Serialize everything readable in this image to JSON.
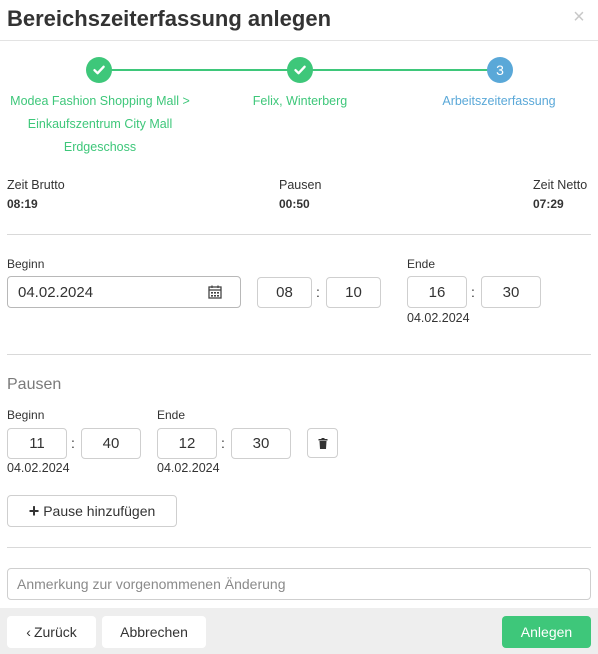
{
  "dialog": {
    "title": "Bereichszeiterfassung anlegen",
    "close_icon": "×"
  },
  "steps": [
    {
      "label": "Modea Fashion Shopping Mall > Einkaufszentrum City Mall Erdgeschoss",
      "state": "done",
      "color": "#3ec77a"
    },
    {
      "label": "Felix, Winterberg",
      "state": "done",
      "color": "#3ec77a"
    },
    {
      "label": "Arbeitszeiterfassung",
      "state": "active",
      "number": "3",
      "color": "#5aa8d8"
    }
  ],
  "summary": {
    "brutto_label": "Zeit Brutto",
    "brutto_value": "08:19",
    "pausen_label": "Pausen",
    "pausen_value": "00:50",
    "netto_label": "Zeit Netto",
    "netto_value": "07:29"
  },
  "work": {
    "beginn_label": "Beginn",
    "beginn_date": "04.02.2024",
    "beginn_hour": "08",
    "beginn_minute": "10",
    "ende_label": "Ende",
    "ende_hour": "16",
    "ende_minute": "30",
    "ende_date": "04.02.2024"
  },
  "pausen": {
    "title": "Pausen",
    "items": [
      {
        "beginn_label": "Beginn",
        "beginn_hour": "11",
        "beginn_minute": "40",
        "beginn_date": "04.02.2024",
        "ende_label": "Ende",
        "ende_hour": "12",
        "ende_minute": "30",
        "ende_date": "04.02.2024"
      }
    ],
    "add_label": "Pause hinzufügen"
  },
  "remark": {
    "placeholder": "Anmerkung zur vorgenommenen Änderung"
  },
  "footer": {
    "back_label": "Zurück",
    "cancel_label": "Abbrechen",
    "create_label": "Anlegen"
  },
  "colors": {
    "accent_green": "#3ec77a",
    "accent_blue": "#5aa8d8",
    "footer_bg": "#eeeeee"
  }
}
